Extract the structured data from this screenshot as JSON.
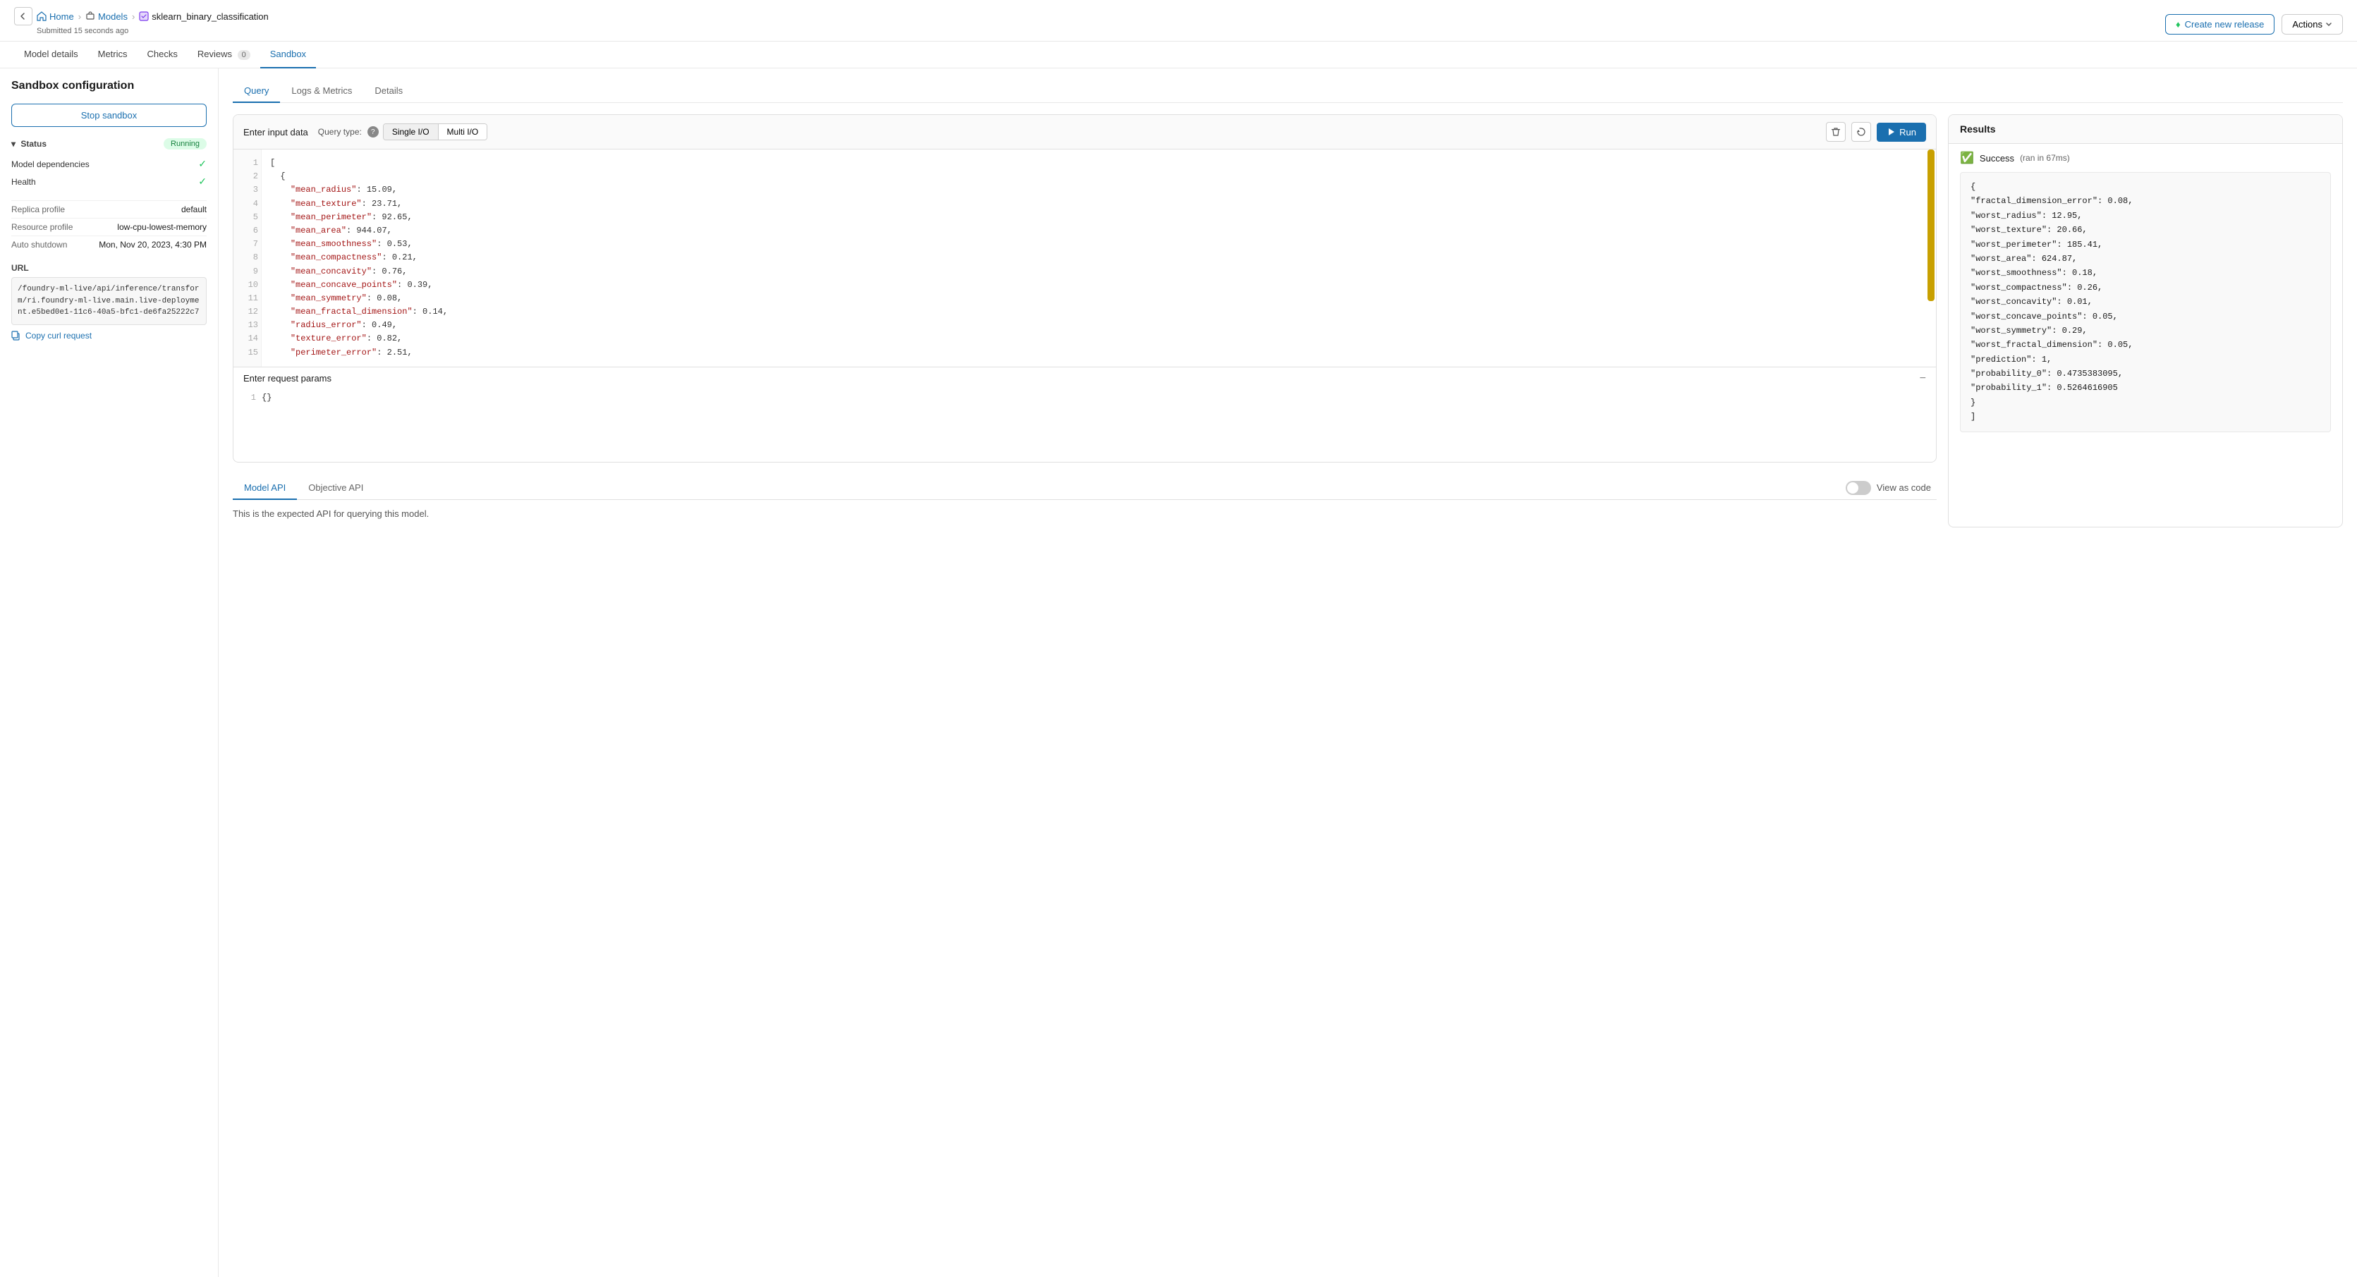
{
  "breadcrumb": {
    "back_label": "←",
    "home_label": "Home",
    "models_label": "Models",
    "current_label": "sklearn_binary_classification",
    "submitted_time": "Submitted 15 seconds ago"
  },
  "header_actions": {
    "create_release_label": "Create new release",
    "actions_label": "Actions"
  },
  "sub_nav": {
    "items": [
      {
        "id": "model-details",
        "label": "Model details",
        "badge": null,
        "active": false
      },
      {
        "id": "metrics",
        "label": "Metrics",
        "badge": null,
        "active": false
      },
      {
        "id": "checks",
        "label": "Checks",
        "badge": null,
        "active": false
      },
      {
        "id": "reviews",
        "label": "Reviews",
        "badge": "0",
        "active": false
      },
      {
        "id": "sandbox",
        "label": "Sandbox",
        "badge": null,
        "active": true
      }
    ]
  },
  "sidebar": {
    "title": "Sandbox configuration",
    "stop_sandbox_label": "Stop sandbox",
    "status_label": "Status",
    "status_value": "Running",
    "status_rows": [
      {
        "label": "Model dependencies",
        "ok": true
      },
      {
        "label": "Health",
        "ok": true
      }
    ],
    "info_rows": [
      {
        "label": "Replica profile",
        "value": "default"
      },
      {
        "label": "Resource profile",
        "value": "low-cpu-lowest-memory"
      },
      {
        "label": "Auto shutdown",
        "value": "Mon, Nov 20, 2023, 4:30 PM"
      }
    ],
    "url_label": "URL",
    "url_value": "/foundry-ml-live/api/inference/transform/ri.foundry-ml-live.main.live-deployment.e5bed0e1-11c6-40a5-bfc1-de6fa25222c7",
    "copy_curl_label": "Copy curl request"
  },
  "inner_tabs": {
    "items": [
      {
        "id": "query",
        "label": "Query",
        "active": true
      },
      {
        "id": "logs-metrics",
        "label": "Logs & Metrics",
        "active": false
      },
      {
        "id": "details",
        "label": "Details",
        "active": false
      }
    ]
  },
  "query_panel": {
    "enter_input_label": "Enter input data",
    "query_type_label": "Query type:",
    "single_io_label": "Single I/O",
    "multi_io_label": "Multi I/O",
    "run_label": "Run",
    "code_lines": [
      {
        "num": "1",
        "content": "["
      },
      {
        "num": "2",
        "content": "  {"
      },
      {
        "num": "3",
        "content": "    \"mean_radius\": 15.09,"
      },
      {
        "num": "4",
        "content": "    \"mean_texture\": 23.71,"
      },
      {
        "num": "5",
        "content": "    \"mean_perimeter\": 92.65,"
      },
      {
        "num": "6",
        "content": "    \"mean_area\": 944.07,"
      },
      {
        "num": "7",
        "content": "    \"mean_smoothness\": 0.53,"
      },
      {
        "num": "8",
        "content": "    \"mean_compactness\": 0.21,"
      },
      {
        "num": "9",
        "content": "    \"mean_concavity\": 0.76,"
      },
      {
        "num": "10",
        "content": "    \"mean_concave_points\": 0.39,"
      },
      {
        "num": "11",
        "content": "    \"mean_symmetry\": 0.08,"
      },
      {
        "num": "12",
        "content": "    \"mean_fractal_dimension\": 0.14,"
      },
      {
        "num": "13",
        "content": "    \"radius_error\": 0.49,"
      },
      {
        "num": "14",
        "content": "    \"texture_error\": 0.82,"
      },
      {
        "num": "15",
        "content": "    \"perimeter_error\": 2.51,"
      }
    ],
    "request_params_label": "Enter request params",
    "params_line": "1",
    "params_content": "{}"
  },
  "results": {
    "title": "Results",
    "success_label": "Success",
    "run_time": "(ran in 67ms)",
    "result_lines": [
      "  \"fractal_dimension_error\": 0.08,",
      "  \"worst_radius\": 12.95,",
      "  \"worst_texture\": 20.66,",
      "  \"worst_perimeter\": 185.41,",
      "  \"worst_area\": 624.87,",
      "  \"worst_smoothness\": 0.18,",
      "  \"worst_compactness\": 0.26,",
      "  \"worst_concavity\": 0.01,",
      "  \"worst_concave_points\": 0.05,",
      "  \"worst_symmetry\": 0.29,",
      "  \"worst_fractal_dimension\": 0.05,",
      "  \"prediction\": 1,",
      "  \"probability_0\": 0.4735383095,",
      "  \"probability_1\": 0.5264616905"
    ]
  },
  "bottom_tabs": {
    "items": [
      {
        "id": "model-api",
        "label": "Model API",
        "active": true
      },
      {
        "id": "objective-api",
        "label": "Objective API",
        "active": false
      }
    ],
    "view_as_code_label": "View as code",
    "bottom_text": "This is the expected API for querying this model."
  }
}
